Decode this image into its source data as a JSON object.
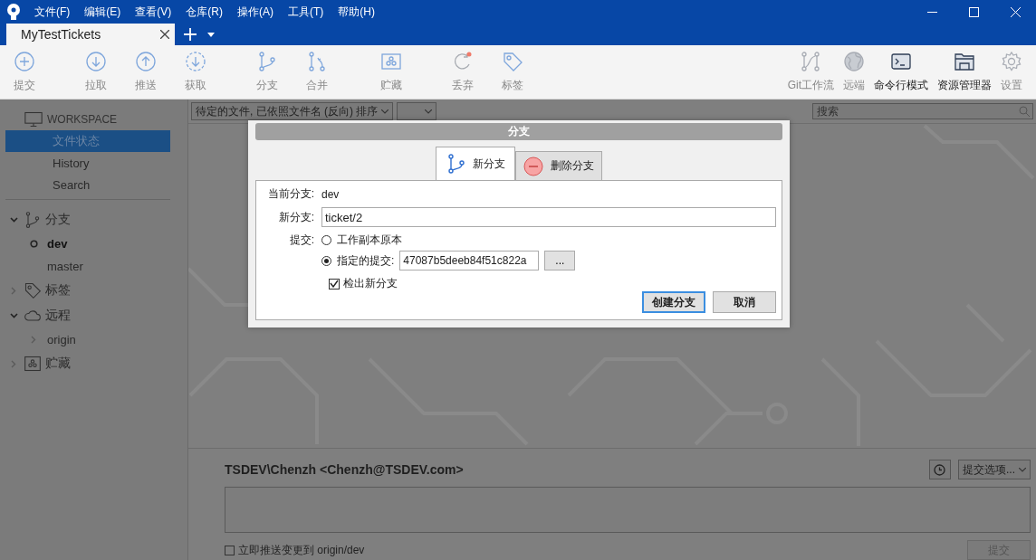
{
  "menu": [
    "文件(F)",
    "编辑(E)",
    "查看(V)",
    "仓库(R)",
    "操作(A)",
    "工具(T)",
    "帮助(H)"
  ],
  "tabs": [
    {
      "label": "MyTestTickets",
      "selected": true
    }
  ],
  "toolbar": {
    "left": [
      {
        "label": "提交",
        "disabled": true
      },
      {
        "label": "拉取",
        "disabled": true
      },
      {
        "label": "推送",
        "disabled": true
      },
      {
        "label": "获取",
        "disabled": true
      },
      {
        "label": "分支",
        "disabled": true
      },
      {
        "label": "合并",
        "disabled": true
      },
      {
        "label": "贮藏",
        "disabled": true
      },
      {
        "label": "丢弃",
        "disabled": true
      },
      {
        "label": "标签",
        "disabled": true
      }
    ],
    "right": [
      {
        "label": "Git工作流",
        "disabled": true
      },
      {
        "label": "远端",
        "disabled": true
      },
      {
        "label": "命令行模式",
        "disabled": false
      },
      {
        "label": "资源管理器",
        "disabled": false
      },
      {
        "label": "设置",
        "disabled": true
      }
    ]
  },
  "sidebar": {
    "workspace": "WORKSPACE",
    "items": [
      {
        "label": "文件状态",
        "selected": true
      },
      {
        "label": "History",
        "selected": false
      },
      {
        "label": "Search",
        "selected": false
      }
    ],
    "sections": [
      {
        "label": "分支",
        "expanded": true,
        "children": [
          {
            "label": "dev",
            "current": true
          },
          {
            "label": "master",
            "current": false
          }
        ]
      },
      {
        "label": "标签",
        "expanded": false
      },
      {
        "label": "远程",
        "expanded": true,
        "children": [
          {
            "label": "origin",
            "expanded": false
          }
        ]
      },
      {
        "label": "贮藏",
        "expanded": false
      }
    ]
  },
  "filter": {
    "dropdown": "待定的文件, 已依照文件名 (反向) 排序"
  },
  "search": {
    "placeholder": "搜索"
  },
  "commit_area": {
    "author": "TSDEV\\Chenzh <Chenzh@TSDEV.com>",
    "options": "提交选项...",
    "push": {
      "label": "立即推送变更到 origin/dev",
      "checked": false
    },
    "button": {
      "label": "提交",
      "disabled": true
    }
  },
  "dialog": {
    "title": "分支",
    "tabs": [
      {
        "label": "新分支",
        "selected": true
      },
      {
        "label": "删除分支",
        "selected": false
      }
    ],
    "current_branch": {
      "label": "当前分支:",
      "value": "dev"
    },
    "new_branch": {
      "label": "新分支:",
      "value": "ticket/2"
    },
    "commit": {
      "label": "提交:",
      "options": [
        {
          "label": "工作副本原本",
          "selected": false
        },
        {
          "label": "指定的提交:",
          "selected": true
        }
      ],
      "value": "47087b5deeb84f51c822a",
      "browse": "..."
    },
    "checkout": {
      "label": "检出新分支",
      "checked": true
    },
    "buttons": [
      {
        "label": "创建分支",
        "default": true
      },
      {
        "label": "取消",
        "default": false
      }
    ]
  }
}
